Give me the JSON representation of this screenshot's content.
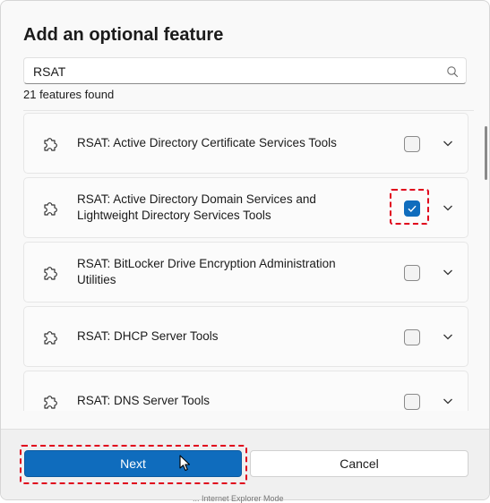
{
  "dialog": {
    "title": "Add an optional feature",
    "search": {
      "value": "RSAT",
      "placeholder": ""
    },
    "results_count": "21 features found",
    "features": [
      {
        "label": "RSAT: Active Directory Certificate Services Tools",
        "checked": false
      },
      {
        "label": "RSAT: Active Directory Domain Services and Lightweight Directory Services Tools",
        "checked": true
      },
      {
        "label": "RSAT: BitLocker Drive Encryption Administration Utilities",
        "checked": false
      },
      {
        "label": "RSAT: DHCP Server Tools",
        "checked": false
      },
      {
        "label": "RSAT: DNS Server Tools",
        "checked": false
      }
    ],
    "buttons": {
      "next": "Next",
      "cancel": "Cancel"
    }
  },
  "background_text": "... Internet Explorer Mode",
  "colors": {
    "accent": "#0f6cbd",
    "highlight": "#e0001b",
    "dialog_bg": "#f9f9f9"
  },
  "icons": {
    "feature": "puzzle-icon",
    "search": "search-icon",
    "expand": "chevron-down-icon"
  }
}
